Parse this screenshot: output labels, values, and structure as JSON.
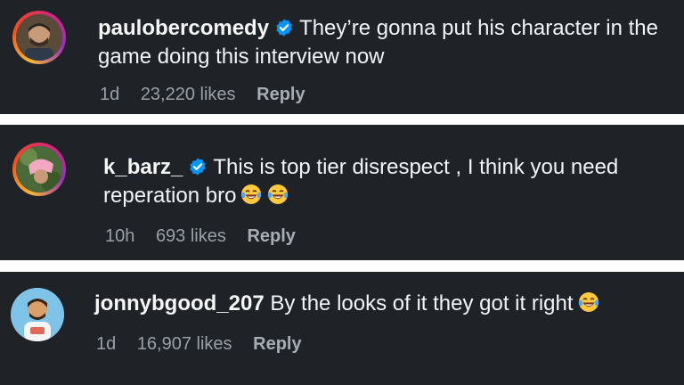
{
  "comments": [
    {
      "username": "paulobercomedy",
      "verified": true,
      "text": "They’re gonna put his character in the game doing this interview now",
      "time": "1d",
      "likes": "23,220 likes",
      "reply_label": "Reply"
    },
    {
      "username": "k_barz_",
      "verified": true,
      "text": "This is top tier disrespect , I think you need reperation bro",
      "emoji_count": 2,
      "time": "10h",
      "likes": "693 likes",
      "reply_label": "Reply"
    },
    {
      "username": "jonnybgood_207",
      "verified": false,
      "text": "By the looks of it they got it right",
      "emoji_count": 1,
      "time": "1d",
      "likes": "16,907 likes",
      "reply_label": "Reply"
    }
  ],
  "colors": {
    "card_bg": "#1f2226",
    "page_bg": "#ffffff",
    "verified_badge": "#0095f6",
    "meta_text": "#9aa0a6"
  },
  "icons": {
    "verified": "verified-badge-icon",
    "emoji": "laughing-tears-emoji-icon"
  }
}
